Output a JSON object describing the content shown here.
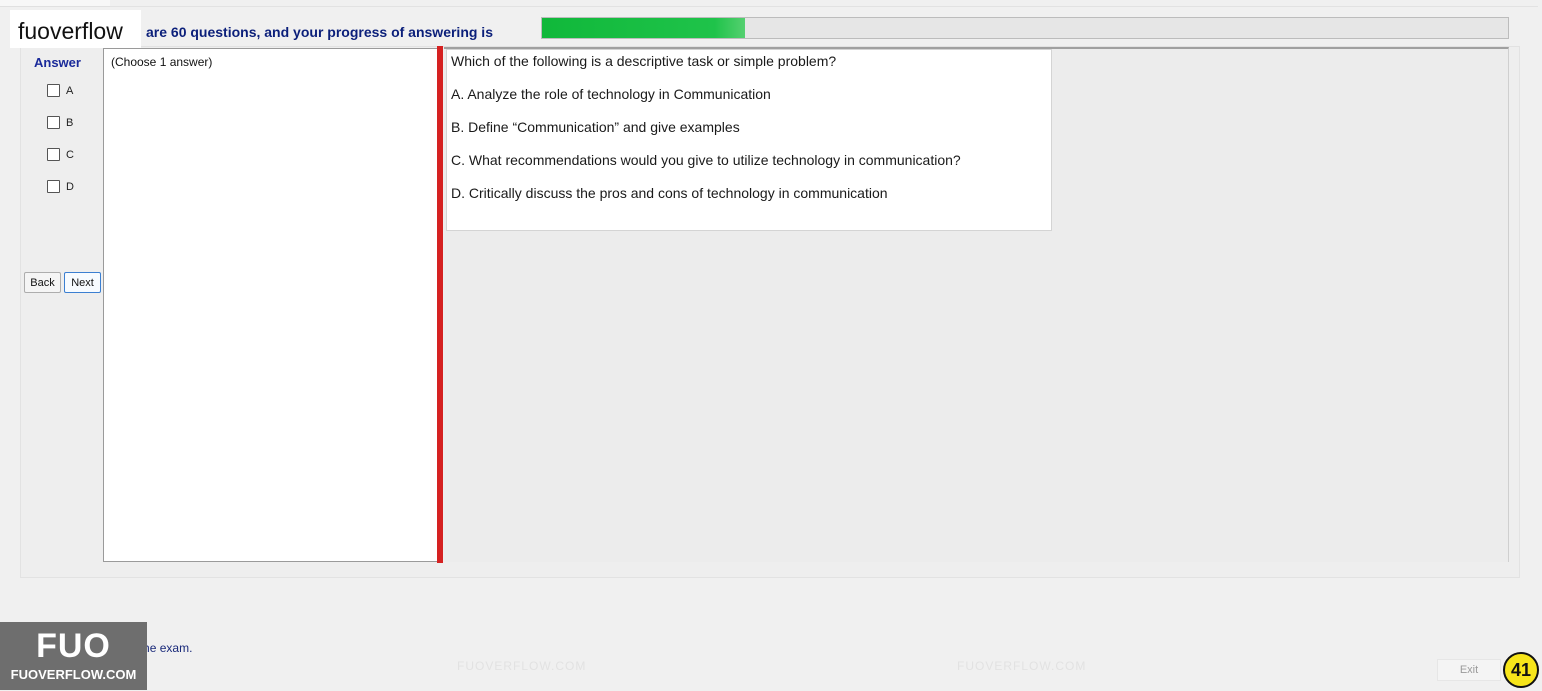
{
  "brand": {
    "label": "fuoverflow"
  },
  "progress": {
    "text": "are 60 questions, and your progress of answering is",
    "fraction": 0.21,
    "fill_color": "#1cbd44"
  },
  "answer": {
    "title": "Answer",
    "options": [
      "A",
      "B",
      "C",
      "D"
    ]
  },
  "nav": {
    "back_label": "Back",
    "next_label": "Next"
  },
  "choose": {
    "text": "(Choose 1 answer)"
  },
  "question": {
    "text": "Which of the following is a descriptive task or simple problem?",
    "options": [
      "A.  Analyze the role of technology in Communication",
      "B.  Define “Communication” and give examples",
      "C.  What recommendations would you give to utilize technology in communication?",
      "D.  Critically discuss the pros and cons of technology in communication"
    ]
  },
  "watermark": {
    "text": "FUOVERFLOW.COM"
  },
  "finish": {
    "text": "ant to finish the exam."
  },
  "logo": {
    "big": "FUO",
    "small": "FUOVERFLOW.COM"
  },
  "exit": {
    "label": "Exit"
  },
  "page_badge": {
    "number": "41"
  },
  "colors": {
    "splitter": "#d52121",
    "accent_text": "#0b1f7a",
    "badge": "#f7e51a"
  }
}
